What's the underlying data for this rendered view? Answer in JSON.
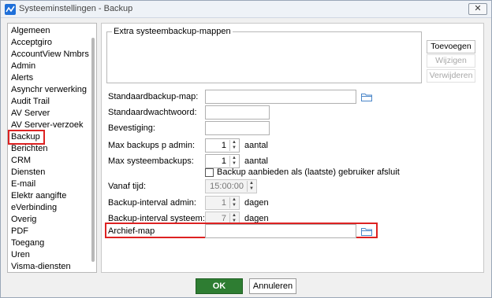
{
  "window": {
    "title": "Systeeminstellingen - Backup",
    "close_glyph": "✕",
    "accent": "#1e6fd9"
  },
  "sidebar": {
    "items": [
      {
        "label": "Algemeen"
      },
      {
        "label": "Acceptgiro"
      },
      {
        "label": "AccountView Nmbrs"
      },
      {
        "label": "Admin"
      },
      {
        "label": "Alerts"
      },
      {
        "label": "Asynchr verwerking"
      },
      {
        "label": "Audit Trail"
      },
      {
        "label": "AV Server"
      },
      {
        "label": "AV Server-verzoek"
      },
      {
        "label": "Backup",
        "selected": true
      },
      {
        "label": "Berichten"
      },
      {
        "label": "CRM"
      },
      {
        "label": "Diensten"
      },
      {
        "label": "E-mail"
      },
      {
        "label": "Elektr aangifte"
      },
      {
        "label": "eVerbinding"
      },
      {
        "label": "Overig"
      },
      {
        "label": "PDF"
      },
      {
        "label": "Toegang"
      },
      {
        "label": "Uren"
      },
      {
        "label": "Visma-diensten"
      }
    ]
  },
  "extra_mappen": {
    "legend": "Extra systeembackup-mappen",
    "buttons": {
      "add": "Toevoegen",
      "change": "Wijzigen",
      "remove": "Verwijderen"
    }
  },
  "fields": {
    "std_backup_map": {
      "label": "Standaardbackup-map:",
      "value": ""
    },
    "std_wachtwoord": {
      "label": "Standaardwachtwoord:",
      "value": ""
    },
    "bevestiging": {
      "label": "Bevestiging:",
      "value": ""
    },
    "max_admin": {
      "label": "Max backups p admin:",
      "value": "1",
      "unit": "aantal"
    },
    "max_systeem": {
      "label": "Max systeembackups:",
      "value": "1",
      "unit": "aantal"
    },
    "backup_aanbieden": {
      "label": "Backup aanbieden als (laatste) gebruiker afsluit",
      "checked": false
    },
    "vanaf_tijd": {
      "label": "Vanaf tijd:",
      "value": "15:00:00"
    },
    "interval_admin": {
      "label": "Backup-interval admin:",
      "value": "1",
      "unit": "dagen"
    },
    "interval_systeem": {
      "label": "Backup-interval systeem:",
      "value": "7",
      "unit": "dagen"
    },
    "archief_map": {
      "label": "Archief-map",
      "value": ""
    }
  },
  "footer": {
    "ok": "OK",
    "cancel": "Annuleren"
  },
  "icons": {
    "folder": "folder-icon",
    "app": "app-icon",
    "close": "close-icon"
  }
}
